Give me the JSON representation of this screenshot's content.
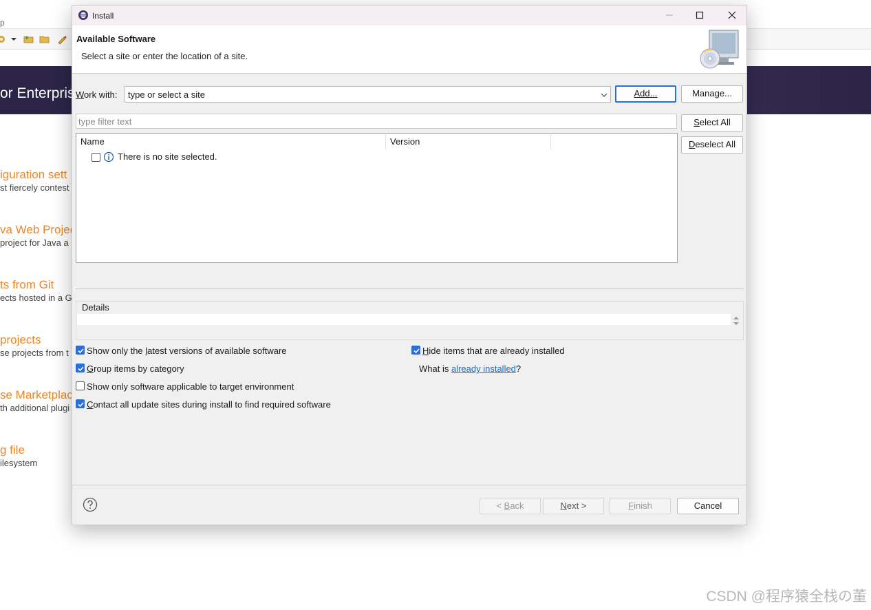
{
  "background": {
    "menu_fragment": "p",
    "banner_title": "or Enterpris",
    "welcome_items": [
      {
        "title": "iguration sett",
        "desc": "st fiercely contest"
      },
      {
        "title": "va Web Projec",
        "desc": "project for Java a"
      },
      {
        "title": "ts from Git",
        "desc": "ects hosted in a G"
      },
      {
        "title": "projects",
        "desc": "se projects from t"
      },
      {
        "title": "se Marketplac",
        "desc": "th additional plugi"
      },
      {
        "title": "g file",
        "desc": "ilesystem"
      }
    ],
    "watermark": "CSDN @程序猿全栈の董"
  },
  "dialog": {
    "title": "Install",
    "header": {
      "title": "Available Software",
      "description": "Select a site or enter the location of a site."
    },
    "work_with": {
      "label_prefix": "W",
      "label_rest": "ork with:",
      "value": "type or select a site"
    },
    "buttons": {
      "add": "Add...",
      "manage": "Manage...",
      "select_all_key": "S",
      "select_all_rest": "elect All",
      "deselect_all_key": "D",
      "deselect_all_rest": "eselect All"
    },
    "filter_placeholder": "type filter text",
    "table": {
      "columns": [
        "Name",
        "Version"
      ],
      "rows": [
        {
          "text": "There is no site selected.",
          "checked": false,
          "icon": "info-icon"
        }
      ]
    },
    "details_label": "Details",
    "options": {
      "latest_pre": "Show only the ",
      "latest_key": "l",
      "latest_post": "atest versions of available software",
      "group_key": "G",
      "group_post": "roup items by category",
      "target_env": "Show only software applicable to target environment",
      "contact_key": "C",
      "contact_post": "ontact all update sites during install to find required software",
      "hide_key": "H",
      "hide_post": "ide items that are already installed",
      "what_is": "What is ",
      "already_installed": "already installed",
      "question": "?"
    },
    "option_states": {
      "latest": true,
      "group": true,
      "target_env": false,
      "contact": true,
      "hide": true
    },
    "footer": {
      "back_pre": "< ",
      "back_key": "B",
      "back_post": "ack",
      "next_key": "N",
      "next_post": "ext >",
      "finish_key": "F",
      "finish_post": "inish",
      "cancel": "Cancel"
    },
    "colors": {
      "accent": "#2b6fd6",
      "link": "#1a6cc7",
      "banner_link": "#e9872a"
    }
  }
}
